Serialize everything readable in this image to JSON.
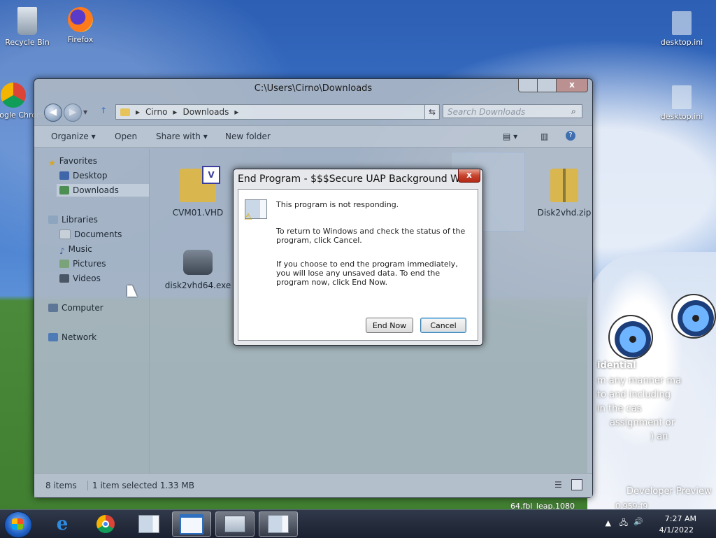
{
  "desktop": {
    "icons": [
      {
        "label": "Recycle Bin"
      },
      {
        "label": "Firefox"
      },
      {
        "label": "Google Chrome"
      },
      {
        "label": "desktop.ini"
      },
      {
        "label": "desktop.ini"
      }
    ],
    "wallpaper_text": [
      "idential",
      "m any manner ma",
      "to and including",
      "in the cas",
      "assignment or",
      ") an",
      "Developer Preview",
      "64.fbl_leap.1080",
      "0.959-f9"
    ]
  },
  "explorer": {
    "title": "C:\\Users\\Cirno\\Downloads",
    "breadcrumb": [
      "Cirno",
      "Downloads"
    ],
    "search_placeholder": "Search Downloads",
    "toolbar": {
      "organize": "Organize ▾",
      "open": "Open",
      "share_with": "Share with ▾",
      "new_folder": "New folder"
    },
    "nav": {
      "favorites": "Favorites",
      "desktop": "Desktop",
      "downloads": "Downloads",
      "libraries": "Libraries",
      "documents": "Documents",
      "music": "Music",
      "pictures": "Pictures",
      "videos": "Videos",
      "computer": "Computer",
      "network": "Network"
    },
    "files": [
      {
        "name": "CVM01.VHD"
      },
      {
        "name": "Disk2vhd.zip"
      },
      {
        "name": "disk2vhd64.exe"
      }
    ],
    "status": {
      "count": "8 items",
      "selected": "1 item selected  1.33 MB"
    }
  },
  "dialog": {
    "title": "End Program - $$$Secure UAP Background Wi...",
    "line1": "This program is not responding.",
    "line2": "To return to Windows and check the status of the program, click Cancel.",
    "line3": "If you choose to end the program immediately, you will lose any unsaved data. To end the program now, click End Now.",
    "end_now": "End Now",
    "cancel": "Cancel",
    "close": "x"
  },
  "taskbar": {
    "time": "7:27 AM",
    "date": "4/1/2022"
  },
  "colors": {
    "accent": "#2d5fb4",
    "close_red": "#c7442e",
    "taskbar": "#1a2030"
  }
}
